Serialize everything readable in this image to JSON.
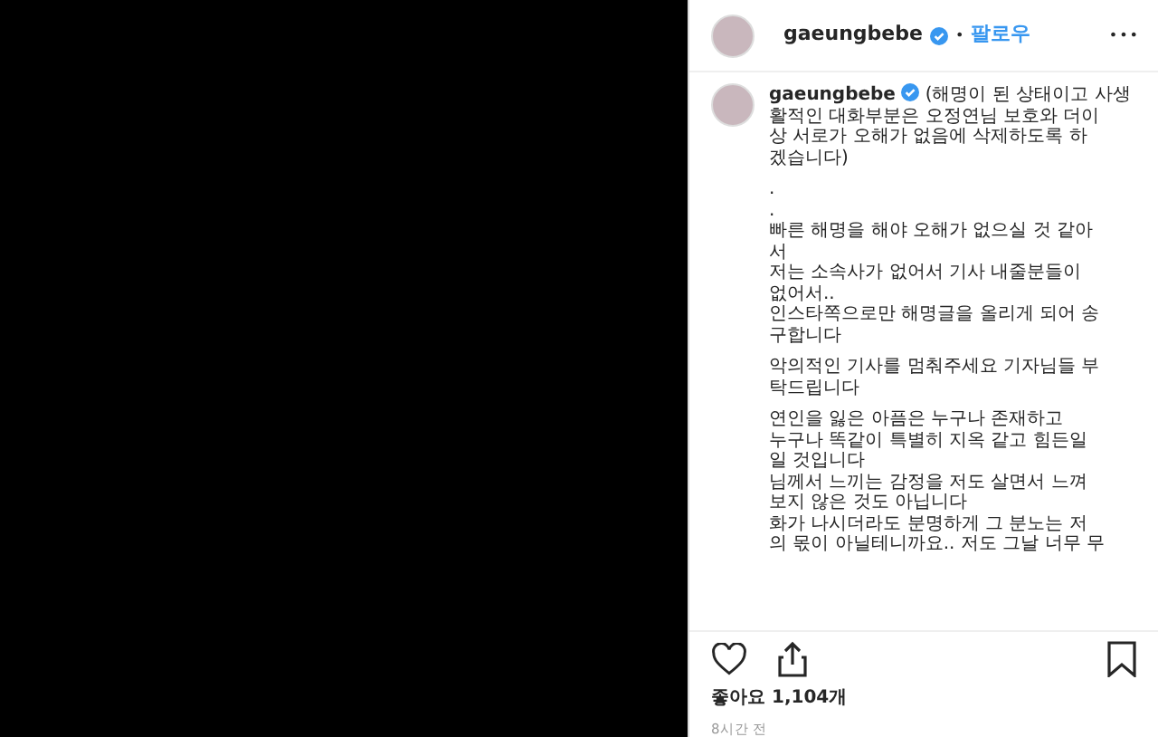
{
  "header": {
    "username": "gaeungbebe",
    "verified": true,
    "separator": "•",
    "follow": "팔로우",
    "more": "•••"
  },
  "caption": {
    "username": "gaeungbebe",
    "verified": true,
    "paragraphs": [
      [
        "(해명이 된 상태이고 사생",
        "활적인 대화부분은 오정연님 보호와 더이",
        "상 서로가 오해가 없음에 삭제하도록 하",
        "겠습니다)"
      ],
      [
        ".",
        ".",
        "빠른 해명을 해야 오해가 없으실 것 같아",
        "서",
        "저는 소속사가 없어서 기사 내줄분들이",
        "없어서..",
        "인스타쪽으로만 해명글을 올리게 되어 송",
        "구합니다"
      ],
      [
        "악의적인 기사를 멈춰주세요 기자님들 부",
        "탁드립니다"
      ],
      [
        "연인을 잃은 아픔은 누구나 존재하고",
        "누구나 똑같이 특별히 지옥 같고 힘든일",
        "일 것입니다",
        "님께서 느끼는 감정을 저도 살면서 느껴",
        "보지 않은 것도 아닙니다",
        "화가 나시더라도 분명하게 그 분노는 저",
        "의 몫이 아닐테니까요.. 저도 그날 너무 무"
      ]
    ]
  },
  "actions": {
    "liked": false,
    "saved": false
  },
  "likes": "좋아요 1,104개",
  "time": "8시간 전"
}
